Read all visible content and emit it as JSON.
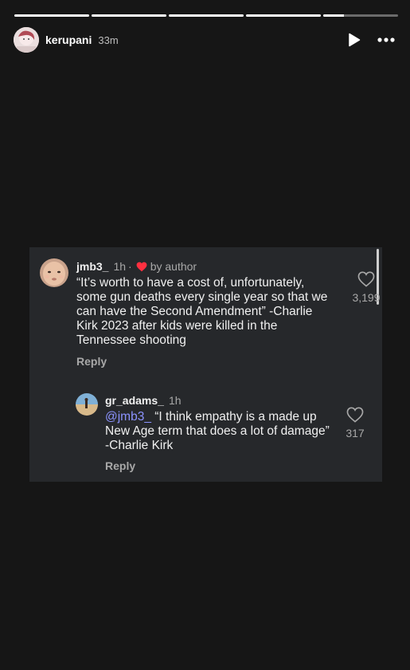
{
  "story": {
    "username": "kerupani",
    "time": "33m",
    "progress": [
      1,
      1,
      1,
      1,
      0.28
    ]
  },
  "icons": {
    "play": "play-icon",
    "more": "more-icon",
    "like": "heart-outline-icon",
    "author_like": "red-heart-icon"
  },
  "colors": {
    "background": "#161616",
    "card": "#26282b",
    "mention": "#8c93ff",
    "heart": "#ff3040"
  },
  "comments": [
    {
      "handle": "jmb3_",
      "time": "1h",
      "dot": "·",
      "author_like": "by author",
      "text": "“It’s worth to have a cost of, unfortunately, some gun deaths every single year so that we can have the Second Amendment” -Charlie Kirk 2023 after kids were killed in the Tennessee shooting",
      "reply": "Reply",
      "likes": "3,199"
    },
    {
      "handle": "gr_adams_",
      "time": "1h",
      "mention": "@jmb3_",
      "text": " “I think empathy is a made up New Age term that does a lot of damage” -Charlie Kirk",
      "reply": "Reply",
      "likes": "317"
    }
  ]
}
